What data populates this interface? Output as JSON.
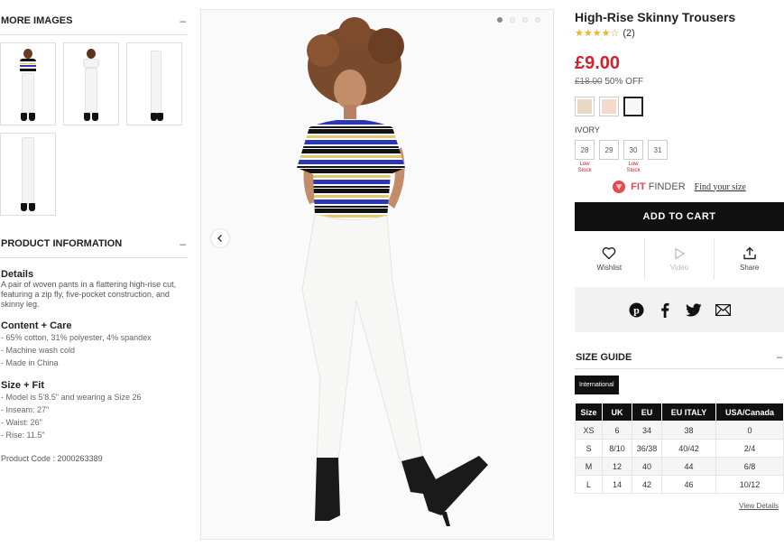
{
  "more_images": {
    "heading": "MORE IMAGES",
    "toggle": "–",
    "thumbnails": [
      "front-pose",
      "front-pose",
      "side-pose",
      "back-pose"
    ]
  },
  "product_info": {
    "heading": "PRODUCT INFORMATION",
    "toggle": "–",
    "details_title": "Details",
    "details_text": "A pair of woven pants in a flattering high-rise cut, featuring a zip fly, five-pocket construction, and skinny leg.",
    "content_title": "Content + Care",
    "content_items": [
      "- 65% cotton, 31% polyester, 4% spandex",
      "- Machine wash cold",
      "- Made in China"
    ],
    "size_fit_title": "Size + Fit",
    "size_fit_items": [
      "- Model is 5'8.5\" and wearing a Size 26",
      "- Inseam: 27\"",
      "- Waist: 26\"",
      "- Rise: 11.5\""
    ],
    "product_code": "Product Code : 2000263389"
  },
  "gallery": {
    "dots": 4,
    "active_dot": 0
  },
  "product": {
    "title": "High-Rise Skinny Trousers",
    "stars": "★★★★",
    "stars_empty": "☆",
    "rating_count": "(2)",
    "price": "£9.00",
    "was_price": "£18.00",
    "discount": "50% OFF",
    "swatches": [
      "#e9d8c2",
      "#f6d9cc",
      "#f7f7f5"
    ],
    "color_name": "IVORY",
    "sizes": [
      {
        "label": "28",
        "low": "Low Stock"
      },
      {
        "label": "29",
        "low": ""
      },
      {
        "label": "30",
        "low": "Low Stock"
      },
      {
        "label": "31",
        "low": ""
      }
    ],
    "fit_finder_fit": "FIT",
    "fit_finder_label": " FINDER",
    "find_size_link": "Find your size",
    "add_to_cart": "ADD TO CART",
    "actions": {
      "wishlist": "Wishlist",
      "video": "Video",
      "share": "Share"
    }
  },
  "size_guide": {
    "heading": "SIZE GUIDE",
    "toggle": "–",
    "tab": "International",
    "columns": [
      "Size",
      "UK",
      "EU",
      "EU ITALY",
      "USA/Canada"
    ],
    "rows": [
      [
        "XS",
        "6",
        "34",
        "38",
        "0"
      ],
      [
        "S",
        "8/10",
        "36/38",
        "40/42",
        "2/4"
      ],
      [
        "M",
        "12",
        "40",
        "44",
        "6/8"
      ],
      [
        "L",
        "14",
        "42",
        "46",
        "10/12"
      ]
    ],
    "view_details": "View Details"
  },
  "colors": {
    "price_red": "#d3202c",
    "accent_black": "#111111",
    "fit_finder_red": "#e8484f",
    "star_gold": "#f0b323"
  }
}
